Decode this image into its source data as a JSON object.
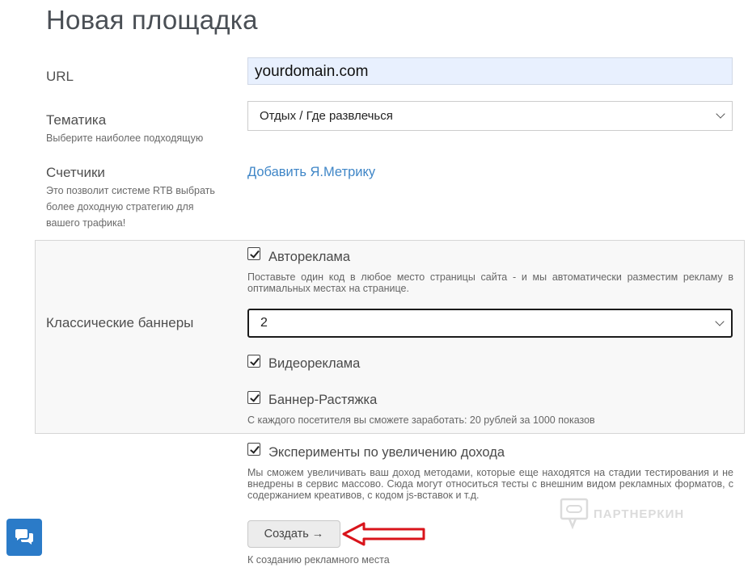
{
  "page": {
    "title": "Новая площадка"
  },
  "url_field": {
    "label": "URL",
    "value": "yourdomain.com"
  },
  "theme": {
    "label": "Тематика",
    "help": "Выберите наиболее подходящую",
    "selected": "Отдых / Где развлечься"
  },
  "counters": {
    "label": "Счетчики",
    "help": "Это позволит системе RTB выбрать более доходную стратегию для вашего трафика!",
    "link": "Добавить Я.Метрику"
  },
  "classic_banners": {
    "label": "Классические баннеры",
    "auto_ads": {
      "label": "Автореклама",
      "checked": true,
      "help": "Поставьте один код в любое место страницы сайта - и мы автоматически разместим рекламу в оптимальных местах на странице."
    },
    "count_selected": "2",
    "video_ads": {
      "label": "Видеореклама",
      "checked": true
    },
    "stretch_banner": {
      "label": "Баннер-Растяжка",
      "checked": true,
      "help": "С каждого посетителя вы сможете заработать: 20 рублей за 1000 показов"
    }
  },
  "experiments": {
    "label": "Эксперименты по увеличению дохода",
    "checked": true,
    "help": "Мы сможем увеличивать ваш доход методами, которые еще находятся на стадии тестирования и не внедрены в сервис массово. Сюда могут относиться тесты с внешним видом рекламных форматов, с содержанием креативов, с кодом js-вставок и т.д."
  },
  "create": {
    "button_label": "Создать →",
    "help": "К созданию рекламного места"
  },
  "watermark": {
    "text": "ПАРТНЕРКИН"
  },
  "colors": {
    "link": "#3f86c7",
    "chat_button": "#2b7bc8",
    "annotation_arrow": "#d9141b",
    "input_autofill": "#e8f0fe"
  },
  "icons": {
    "chat": "chat-bubbles-icon",
    "select_caret": "chevron-down-icon",
    "checkbox": "checkmark-icon"
  }
}
